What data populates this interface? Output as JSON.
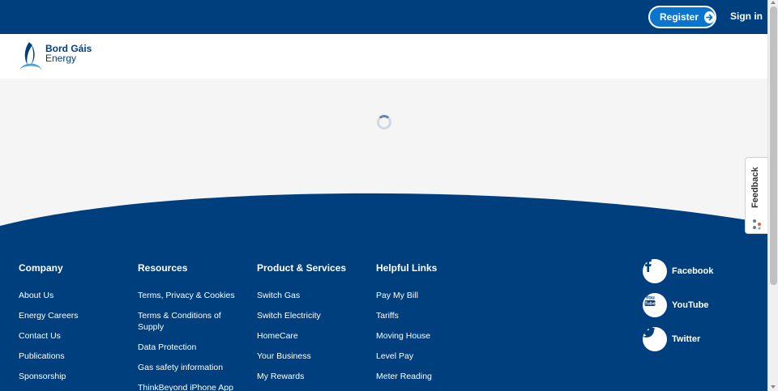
{
  "topbar": {
    "register_label": "Register",
    "signin_label": "Sign in"
  },
  "header": {
    "logo_line1": "Bord Gáis",
    "logo_line2": "Energy"
  },
  "colors": {
    "brand_navy": "#003f7d",
    "button_blue": "#0a74cf",
    "page_bg": "#f5f5f5"
  },
  "footer": {
    "company": {
      "title": "Company",
      "links": [
        "About Us",
        "Energy Careers",
        "Contact Us",
        "Publications",
        "Sponsorship"
      ]
    },
    "resources": {
      "title": "Resources",
      "links": [
        "Terms, Privacy & Cookies",
        "Terms & Conditions of Supply",
        "Data Protection",
        "Gas safety information",
        "ThinkBeyond iPhone App"
      ]
    },
    "products": {
      "title": "Product & Services",
      "links": [
        "Switch Gas",
        "Switch Electricity",
        "HomeCare",
        "Your Business",
        "My Rewards"
      ]
    },
    "helpful": {
      "title": "Helpful Links",
      "links": [
        "Pay My Bill",
        "Tariffs",
        "Moving House",
        "Level Pay",
        "Meter Reading"
      ]
    },
    "social": [
      {
        "label": "Facebook",
        "icon": "facebook-icon"
      },
      {
        "label": "YouTube",
        "icon": "youtube-icon"
      },
      {
        "label": "Twitter",
        "icon": "twitter-icon"
      }
    ]
  },
  "feedback_tab": {
    "label": "Feedback"
  }
}
